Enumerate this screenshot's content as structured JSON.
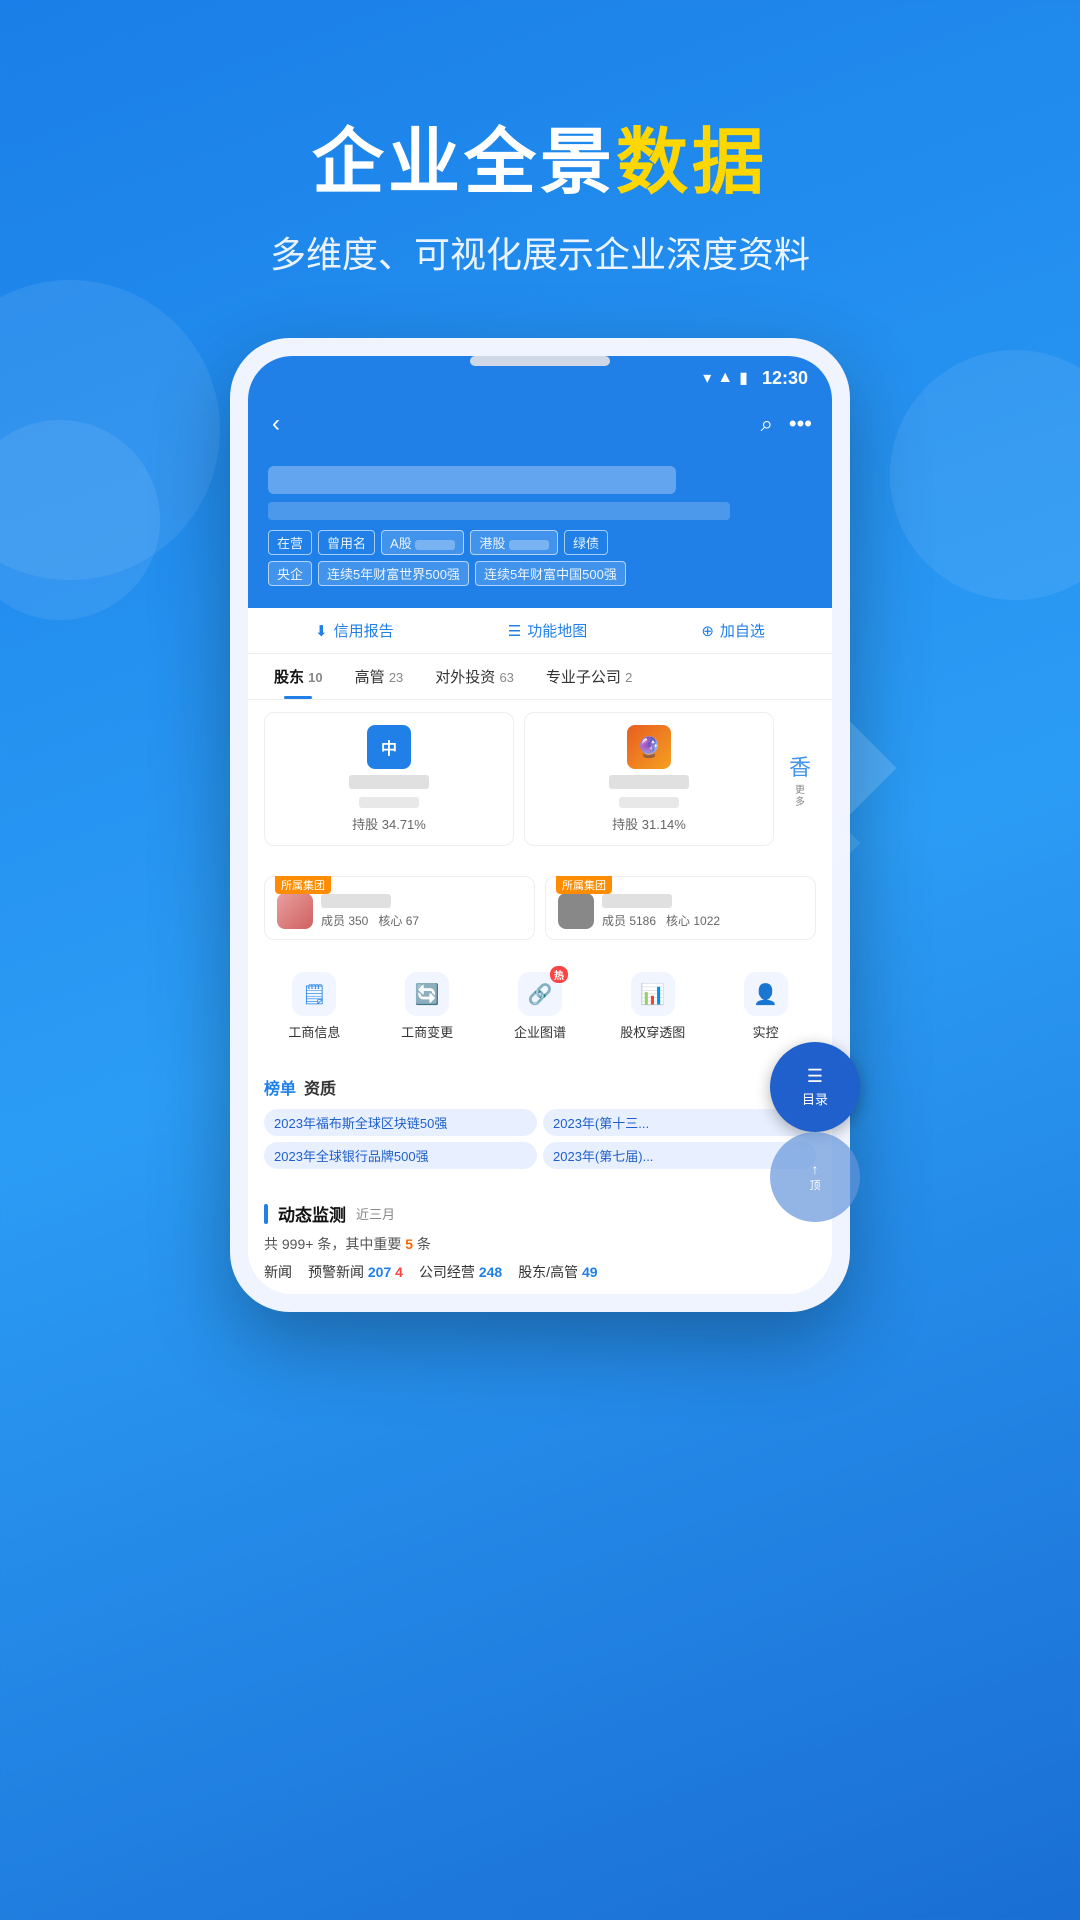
{
  "hero": {
    "title_part1": "企业全景",
    "title_part2": "数据",
    "subtitle": "多维度、可视化展示企业深度资料"
  },
  "statusBar": {
    "time": "12:30"
  },
  "nav": {
    "back_label": "‹",
    "search_label": "○",
    "more_label": "···"
  },
  "company": {
    "tags": [
      "在营",
      "曾用名",
      "A股",
      "港股",
      "绿债",
      "央企",
      "连续5年财富世界500强",
      "连续5年财富中国500强"
    ],
    "actions": [
      "信用报告",
      "功能地图",
      "加自选"
    ]
  },
  "tabs": [
    {
      "label": "股东",
      "count": "10"
    },
    {
      "label": "高管",
      "count": "23"
    },
    {
      "label": "对外投资",
      "count": "63"
    },
    {
      "label": "专业子公司",
      "count": "2"
    }
  ],
  "shareholders": [
    {
      "avatar": "中",
      "percent": "持股 34.71%"
    },
    {
      "avatar": "🔮",
      "percent": "持股 31.14%"
    },
    {
      "avatar": "香",
      "label": "更多"
    }
  ],
  "groups": [
    {
      "badge": "所属集团",
      "members": "成员 350",
      "core": "核心 67"
    },
    {
      "badge": "所属集团",
      "members": "成员 5186",
      "core": "核心 1022"
    }
  ],
  "quickMenu": [
    {
      "label": "工商信息",
      "icon": "🗒",
      "hot": false
    },
    {
      "label": "工商变更",
      "icon": "🔄",
      "hot": false
    },
    {
      "label": "企业图谱",
      "icon": "🔗",
      "hot": true
    },
    {
      "label": "股权穿透图",
      "icon": "📊",
      "hot": false
    },
    {
      "label": "实控",
      "icon": "👤",
      "hot": false
    }
  ],
  "rankings": {
    "section_label": "榜单资质",
    "items": [
      "2023年福布斯全球区块链50强",
      "2023年(第十三...",
      "2023年全球银行品牌500强",
      "2023年(第七届)..."
    ]
  },
  "dynamic": {
    "title": "动态监测",
    "period": "近三月",
    "summary_text": "共 999+ 条，其中重要",
    "summary_count": "5",
    "summary_unit": "条",
    "items": [
      {
        "label": "新闻",
        "value": ""
      },
      {
        "label": "预警新闻",
        "count1": "207",
        "count2": "4"
      },
      {
        "label": "公司经营",
        "count": "248"
      },
      {
        "label": "股东/高管",
        "count": "49"
      }
    ]
  },
  "floatButtons": {
    "menu_label": "目录",
    "back_label": "顶部"
  }
}
